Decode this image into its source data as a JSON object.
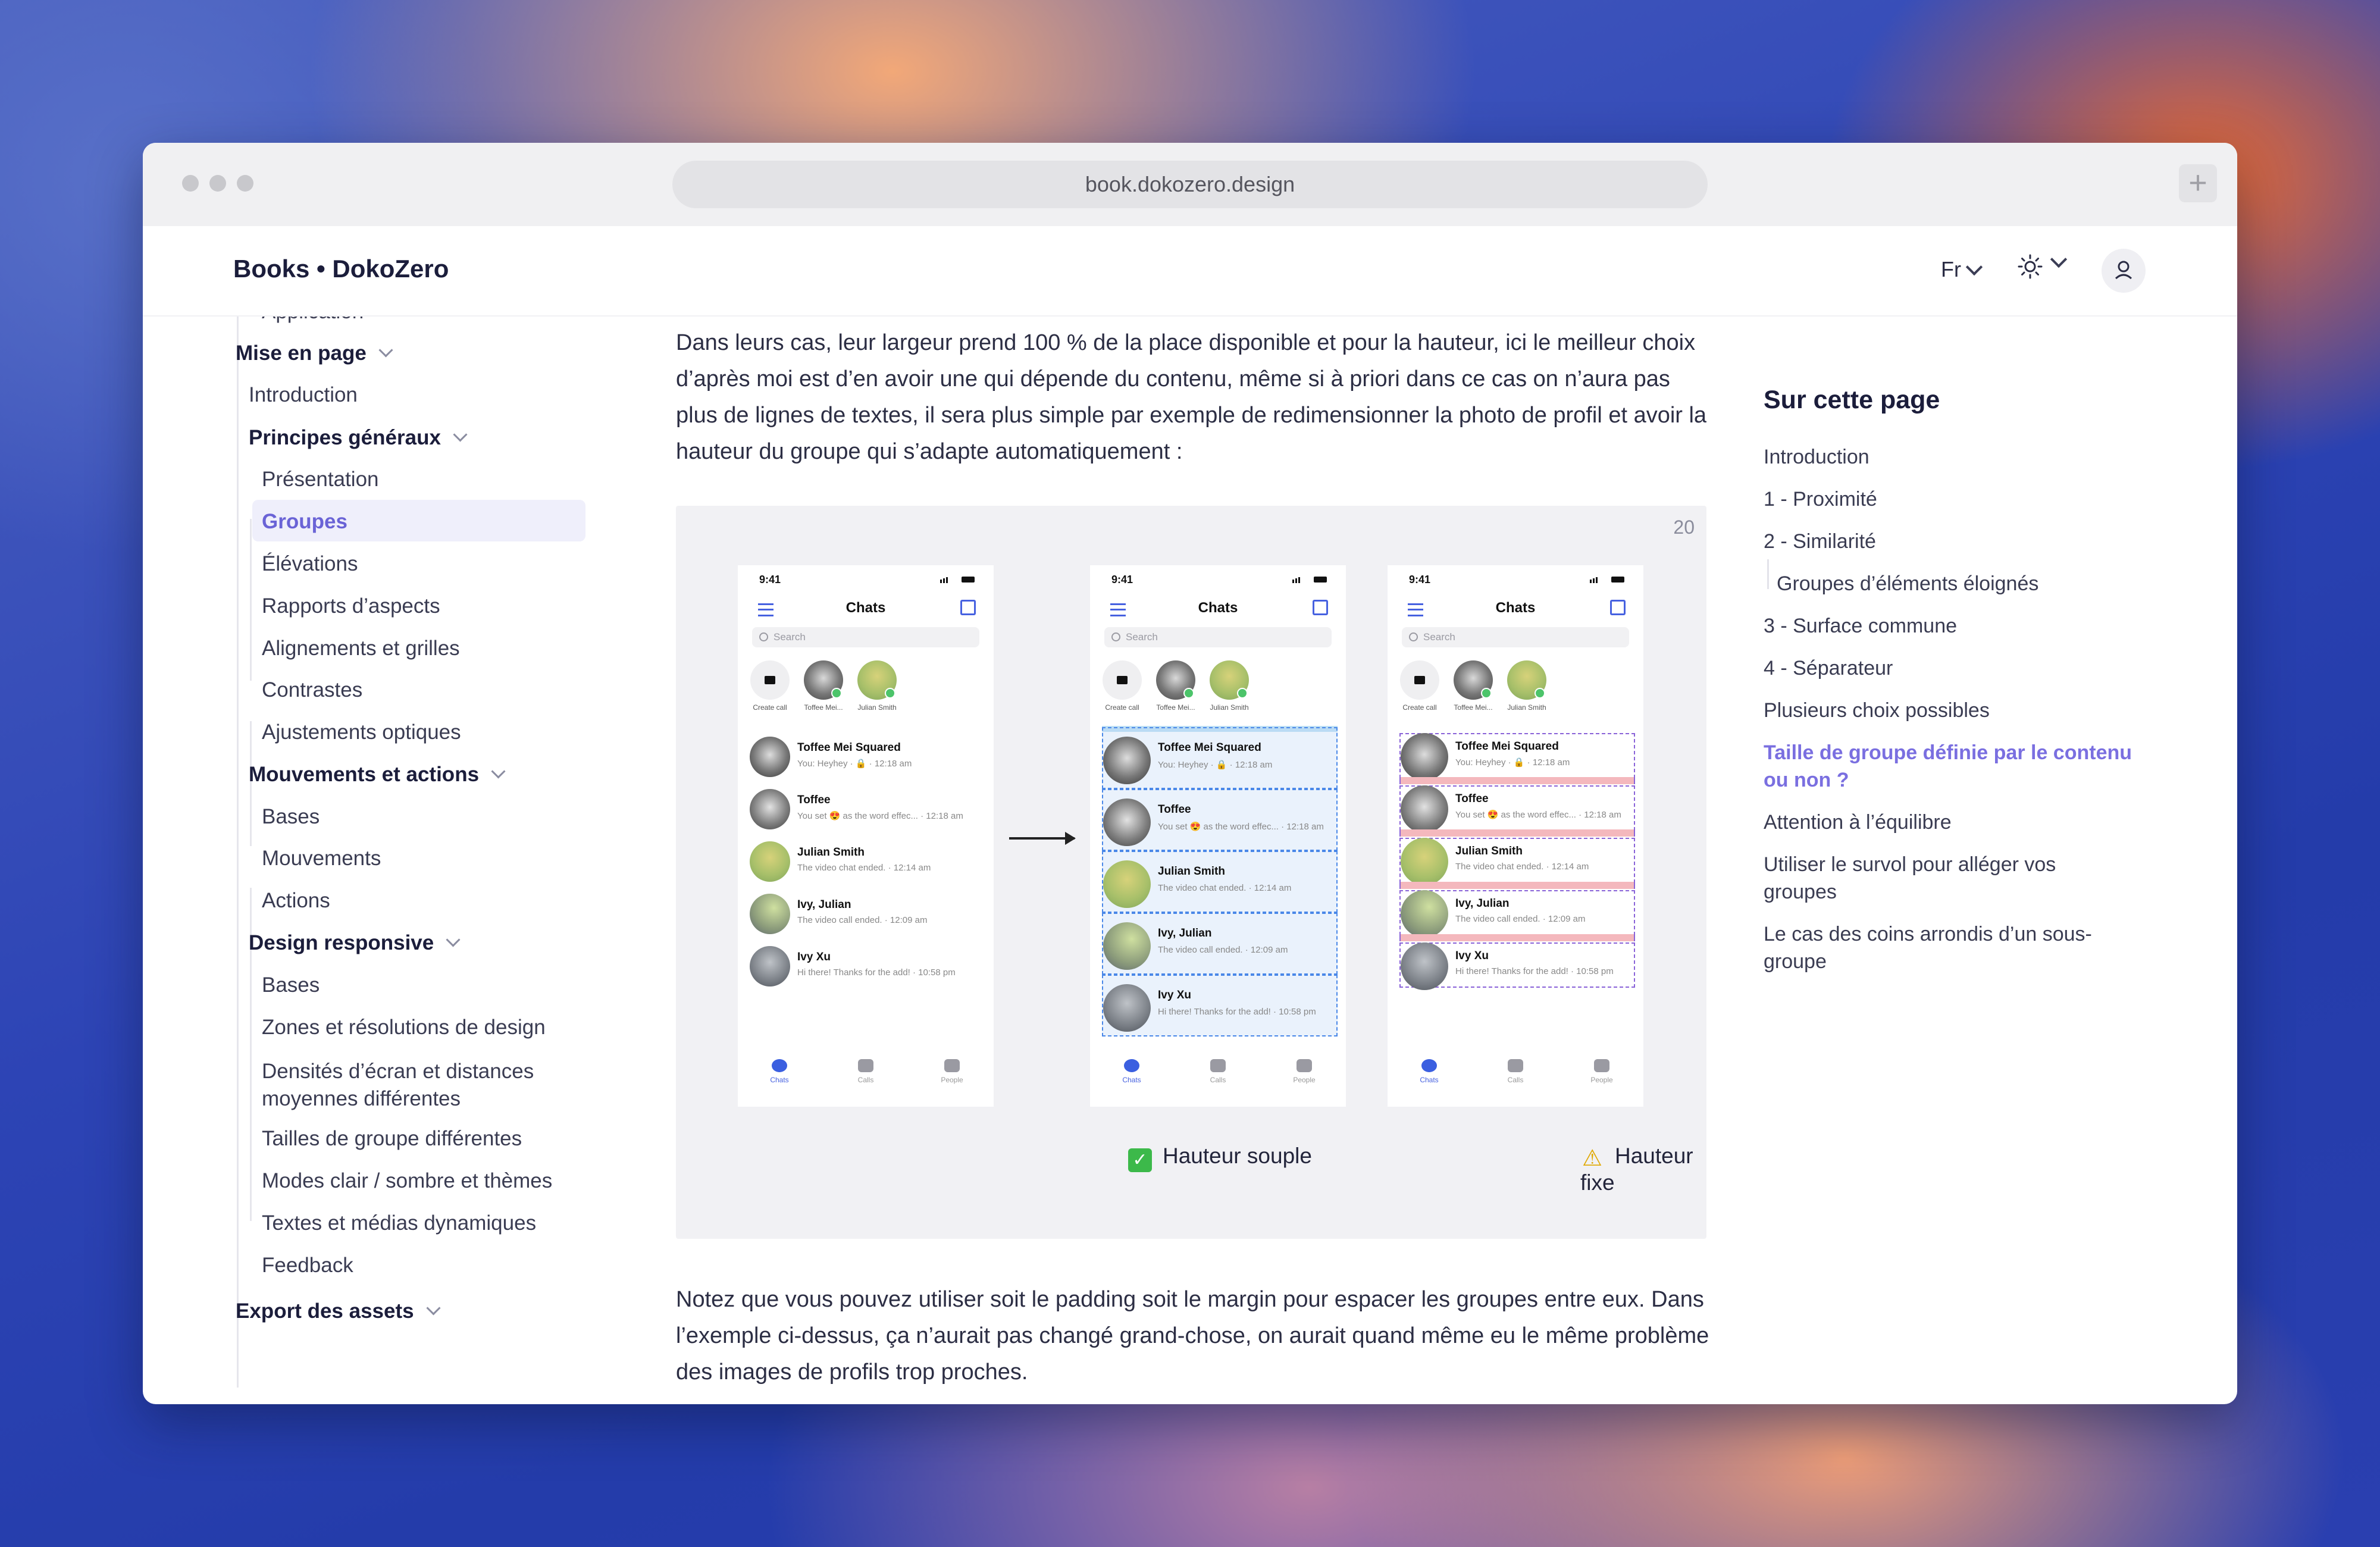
{
  "browser": {
    "url": "book.dokozero.design",
    "new_tab_label": "+"
  },
  "header": {
    "brand": "Books • DokoZero",
    "lang": "Fr"
  },
  "sidebar": {
    "cut_item": "Application",
    "mise_en_page": "Mise en page",
    "introduction": "Introduction",
    "principes": "Principes généraux",
    "principes_items": [
      "Présentation",
      "Groupes",
      "Élévations",
      "Rapports d’aspects",
      "Alignements et grilles",
      "Contrastes",
      "Ajustements optiques"
    ],
    "mouvements": "Mouvements et actions",
    "mouvements_items": [
      "Bases",
      "Mouvements",
      "Actions"
    ],
    "responsive": "Design responsive",
    "responsive_items": [
      "Bases",
      "Zones et résolutions de design",
      "Densités d’écran et distances moyennes différentes",
      "Tailles de groupe différentes",
      "Modes clair / sombre et thèmes",
      "Textes et médias dynamiques",
      "Feedback"
    ],
    "export": "Export des assets"
  },
  "main": {
    "paragraph1": "Dans leurs cas, leur largeur prend 100 % de la place disponible et pour la hauteur, ici le meilleur choix d’après moi est d’en avoir une qui dépende du contenu, même si à priori dans ce cas on n’aura pas plus de lignes de textes, il sera plus simple par exemple de redimensionner la photo de profil et avoir la hauteur du groupe qui s’adapte automatiquement :",
    "figure_number": "20",
    "caption_flex": "Hauteur souple",
    "caption_fixed": "Hauteur fixe",
    "paragraph2": "Notez que vous pouvez utiliser soit le padding soit le margin pour espacer les groupes entre eux. Dans l’exemple ci-dessus, ça n’aurait pas changé grand-chose, on aurait quand même eu le même problème des images de profils trop proches."
  },
  "phone": {
    "time": "9:41",
    "title": "Chats",
    "search": "Search",
    "stories": [
      "Create call",
      "Toffee Mei...",
      "Julian Smith"
    ],
    "chats": [
      {
        "name": "Toffee Mei Squared",
        "msg": "You: Heyhey · 🔒 · 12:18 am"
      },
      {
        "name": "Toffee",
        "msg": "You set 😍 as the word effec... · 12:18 am"
      },
      {
        "name": "Julian Smith",
        "msg": "The video chat ended. · 12:14 am"
      },
      {
        "name": "Ivy, Julian",
        "msg": "The video call ended. · 12:09 am"
      },
      {
        "name": "Ivy Xu",
        "msg": "Hi there! Thanks for the add! · 10:58 pm"
      }
    ],
    "tabs": [
      "Chats",
      "Calls",
      "People"
    ]
  },
  "toc": {
    "title": "Sur cette page",
    "items": [
      "Introduction",
      "1 - Proximité",
      "2 - Similarité",
      "Groupes d’éléments éloignés",
      "3 - Surface commune",
      "4 - Séparateur",
      "Plusieurs choix possibles",
      "Taille de groupe définie par le contenu ou non ?",
      "Attention à l’équilibre",
      "Utiliser le survol pour alléger vos groupes",
      "Le cas des coins arrondis d’un sous-groupe"
    ]
  },
  "colors": {
    "accent": "#6a63d6",
    "text": "#2c2e44",
    "heading": "#1b1d3b"
  }
}
